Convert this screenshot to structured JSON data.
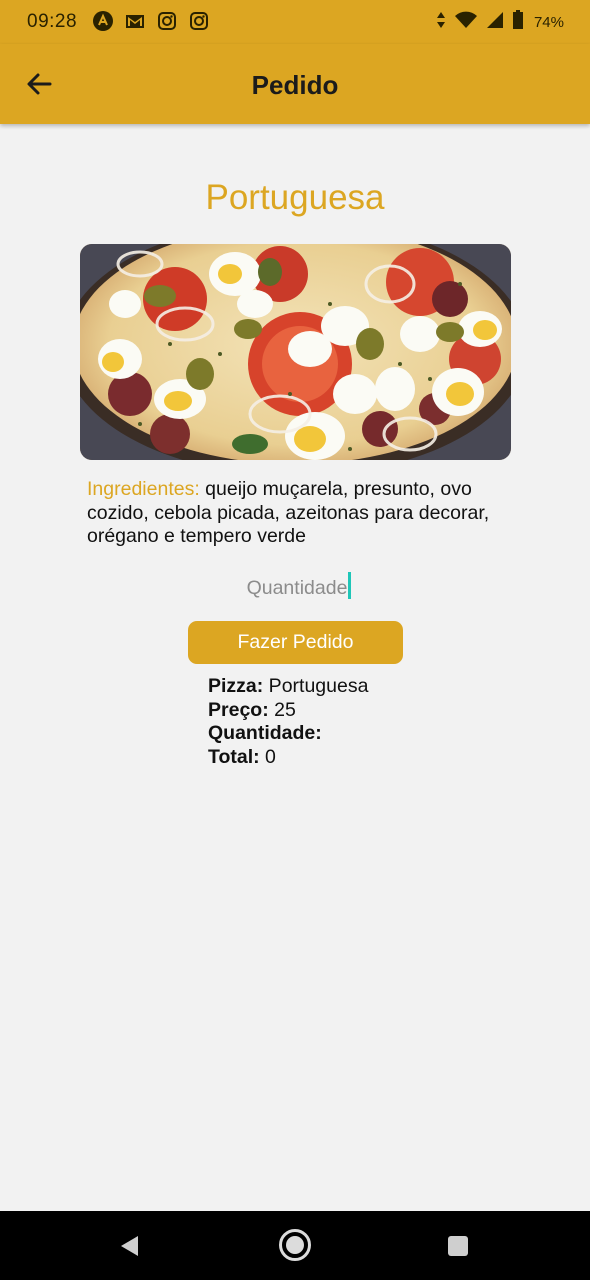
{
  "status_bar": {
    "time": "09:28",
    "battery": "74%",
    "left_icons": [
      "app-a-icon",
      "gmail-icon",
      "instagram-icon",
      "instagram-icon"
    ],
    "right_icons": [
      "data-arrows-icon",
      "wifi-icon",
      "signal-icon",
      "battery-icon"
    ]
  },
  "app_bar": {
    "title": "Pedido",
    "back_icon": "arrow-left-icon"
  },
  "pizza": {
    "name": "Portuguesa",
    "ingredients_label": "Ingredientes:",
    "ingredients_text": " queijo muçarela, presunto, ovo cozido, cebola picada, azeitonas para decorar, orégano e tempero verde"
  },
  "order_form": {
    "quantity_placeholder": "Quantidade",
    "quantity_value": "",
    "button_label": "Fazer Pedido"
  },
  "summary": {
    "pizza_label": "Pizza:",
    "pizza_value": " Portuguesa",
    "price_label": "Preço:",
    "price_value": " 25",
    "quantity_label": "Quantidade:",
    "quantity_value": "",
    "total_label": "Total:",
    "total_value": " 0"
  },
  "colors": {
    "accent": "#dca622",
    "background": "#f2f2f2",
    "caret": "#1fc6b8"
  }
}
